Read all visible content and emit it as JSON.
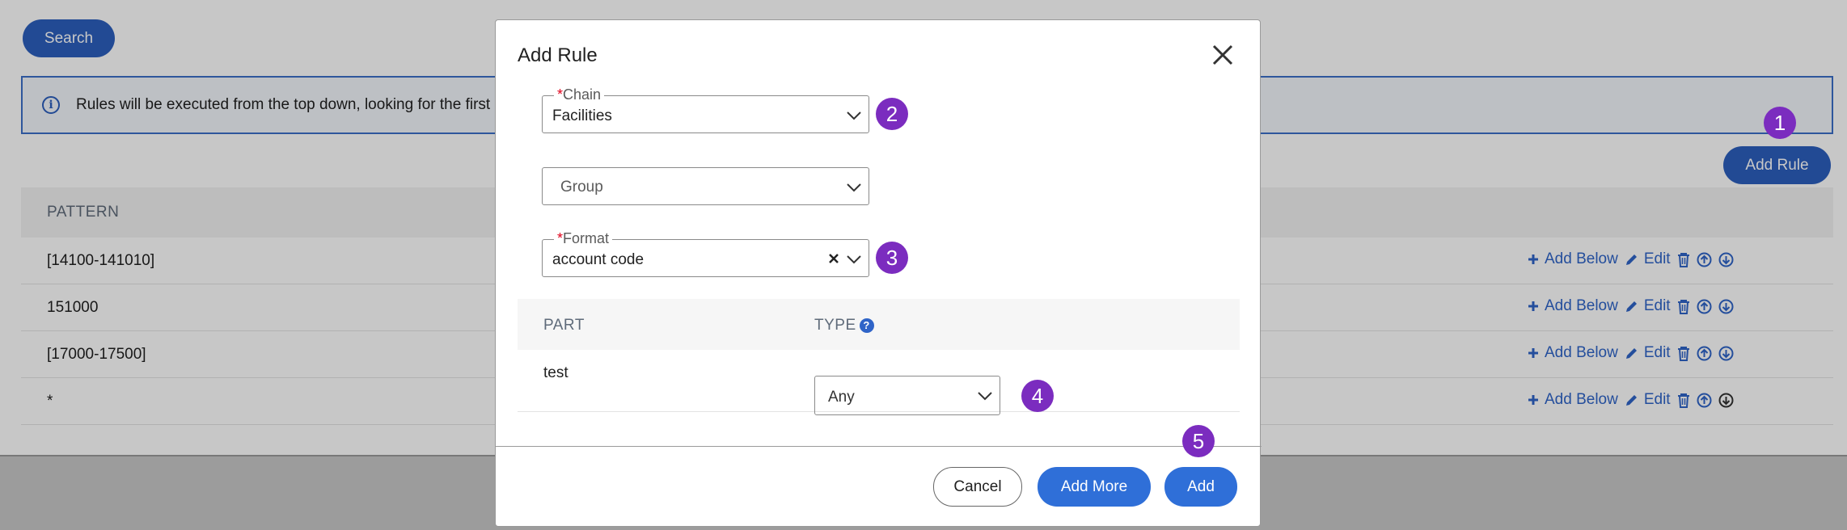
{
  "page": {
    "search_label": "Search",
    "info_text": "Rules will be executed from the top down, looking for the first",
    "add_rule_label": "Add Rule",
    "column_pattern": "PATTERN",
    "rows": [
      {
        "pattern": "[14100-141010]"
      },
      {
        "pattern": "151000"
      },
      {
        "pattern": "[17000-17500]"
      },
      {
        "pattern": "*"
      }
    ],
    "row_actions": {
      "add_below": "Add Below",
      "edit": "Edit"
    }
  },
  "modal": {
    "title": "Add Rule",
    "chain": {
      "required_mark": "*",
      "label": "Chain",
      "value": "Facilities"
    },
    "group": {
      "placeholder": "Group"
    },
    "format": {
      "required_mark": "*",
      "label": "Format",
      "value": "account code"
    },
    "parts_table": {
      "col_part": "PART",
      "col_type": "TYPE",
      "rows": [
        {
          "part": "test",
          "type": "Any"
        }
      ]
    },
    "buttons": {
      "cancel": "Cancel",
      "add_more": "Add More",
      "add": "Add"
    }
  },
  "badges": {
    "b1": "1",
    "b2": "2",
    "b3": "3",
    "b4": "4",
    "b5": "5"
  },
  "colors": {
    "primary": "#2f6fd8",
    "badge": "#7b2cbf",
    "required": "#e0001b",
    "link": "#2f64c8"
  }
}
